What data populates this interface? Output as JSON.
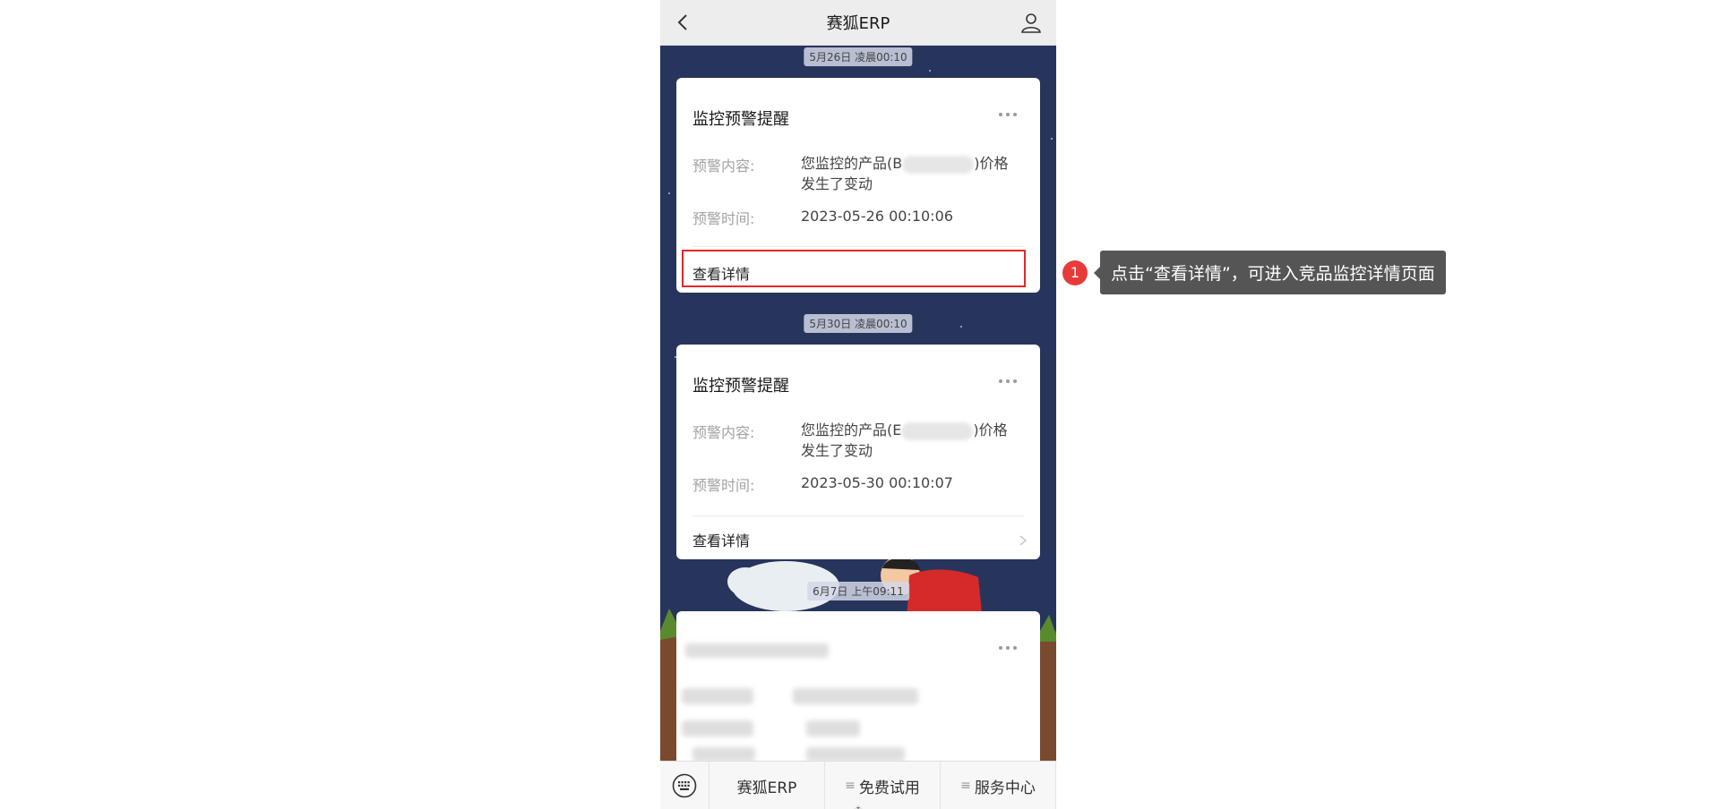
{
  "header": {
    "title": "赛狐ERP"
  },
  "messages": [
    {
      "time": "5月26日 凌晨00:10",
      "title": "监控预警提醒",
      "content_label": "预警内容:",
      "content_prefix": "您监控的产品(B",
      "content_suffix": ")价格",
      "content_line2": "发生了变动",
      "time_label": "预警时间:",
      "time_value": "2023-05-26 00:10:06",
      "detail": "查看详情"
    },
    {
      "time": "5月30日 凌晨00:10",
      "title": "监控预警提醒",
      "content_label": "预警内容:",
      "content_prefix": "您监控的产品(E",
      "content_suffix": ")价格",
      "content_line2": "发生了变动",
      "time_label": "预警时间:",
      "time_value": "2023-05-30 00:10:07",
      "detail": "查看详情"
    },
    {
      "time": "6月7日 上午09:11"
    }
  ],
  "bottom_menu": {
    "items": [
      "赛狐ERP",
      "免费试用",
      "服务中心"
    ]
  },
  "callout": {
    "number": "1",
    "text": "点击“查看详情”，可进入竞品监控详情页面"
  },
  "colors": {
    "highlight": "#e0282a",
    "badge": "#e83a3a",
    "background": "#27355c"
  }
}
